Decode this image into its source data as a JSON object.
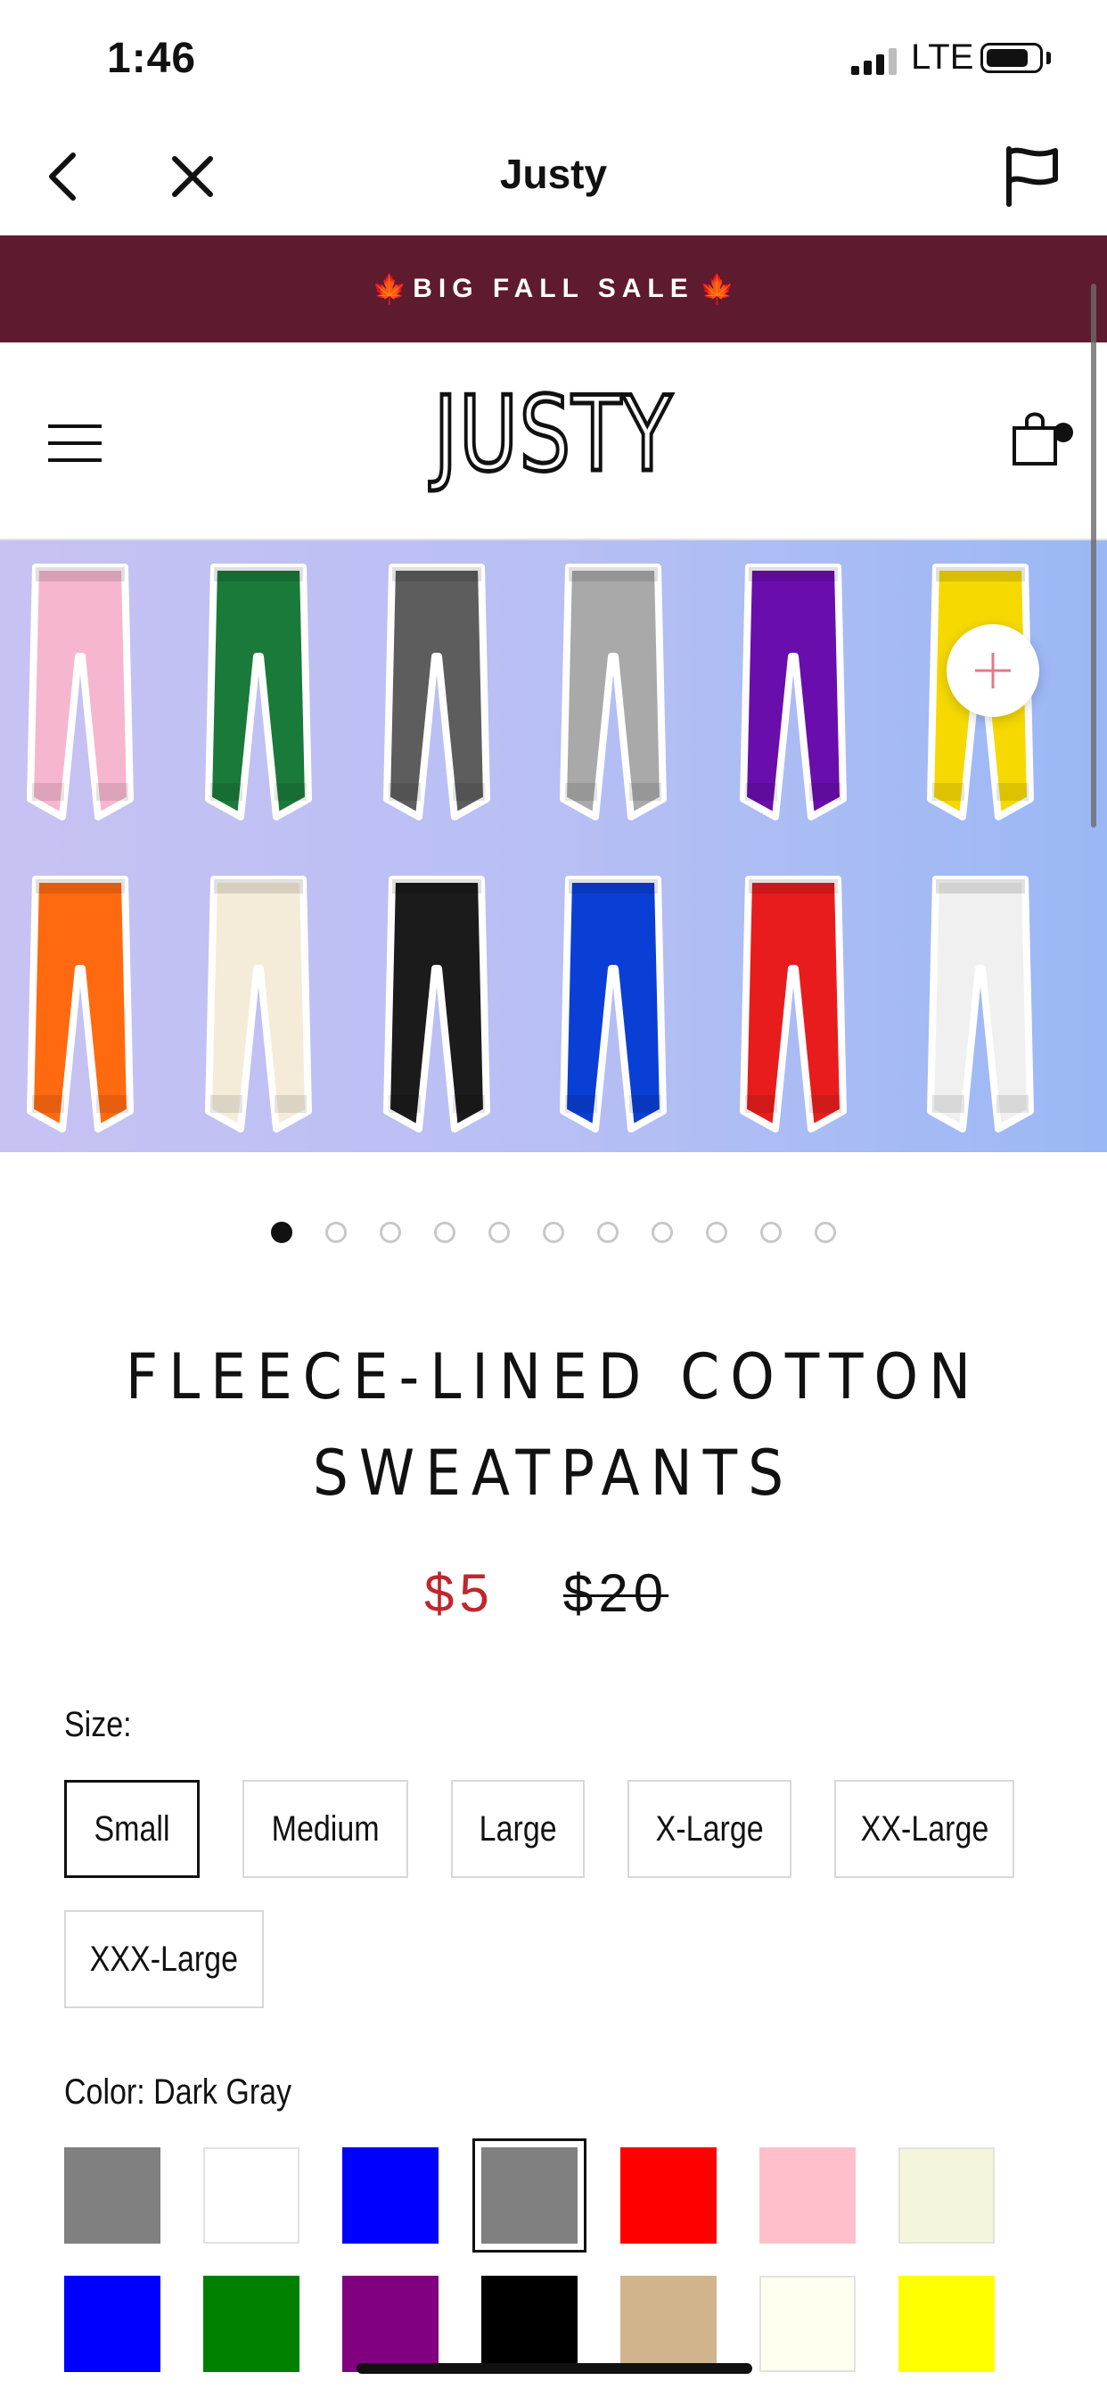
{
  "status_bar": {
    "time": "1:46",
    "network": "LTE",
    "battery_level": 0.8
  },
  "nav": {
    "title": "Justy"
  },
  "sale_banner": {
    "text": "BIG FALL SALE"
  },
  "store": {
    "logo": "JUSTY"
  },
  "hero": {
    "pant_colors": [
      "#f6b6d0",
      "#1a7a3a",
      "#5d5d5d",
      "#a9a9a9",
      "#6a0dad",
      "#f5d900",
      "#ff6a10",
      "#f4ecd8",
      "#1b1b1b",
      "#0a3fd6",
      "#e81c1c",
      "#f0f0f0"
    ],
    "image_count": 11,
    "active_index": 0
  },
  "product": {
    "title_line1": "FLEECE-LINED COTTON",
    "title_line2": "SWEATPANTS",
    "price": "$5",
    "original_price": "$20"
  },
  "size": {
    "label": "Size:",
    "options": [
      "Small",
      "Medium",
      "Large",
      "X-Large",
      "XX-Large",
      "XXX-Large"
    ],
    "selected": "Small"
  },
  "color": {
    "label": "Color: Dark Gray",
    "swatches": [
      "#808080",
      "#ffffff",
      "#0000ff",
      "#808080",
      "#ff0000",
      "#ffc0cb",
      "#f5f5dc",
      "#0000ff",
      "#008000",
      "#800080",
      "#000000",
      "#d2b48c",
      "#fffff0",
      "#ffff00"
    ],
    "selected_index": 3
  }
}
